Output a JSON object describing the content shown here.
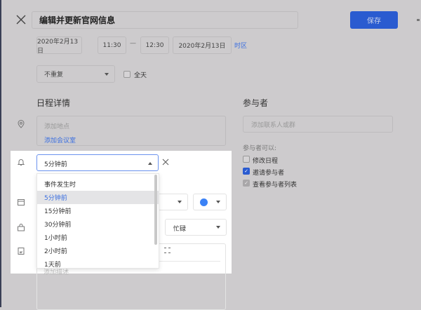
{
  "header": {
    "title": "编辑并更新官网信息",
    "save_label": "保存"
  },
  "time": {
    "start_date": "2020年2月13日",
    "start_time": "11:30",
    "separator": "—",
    "end_time": "12:30",
    "end_date": "2020年2月13日",
    "timezone_link": "时区"
  },
  "repeat": {
    "value": "不重复",
    "all_day_label": "全天",
    "all_day_checked": false
  },
  "details": {
    "heading": "日程详情",
    "location_placeholder": "添加地点",
    "add_room_link": "添加会议室",
    "reminder_value": "5分钟前",
    "busy_value": "忙碌",
    "description_placeholder": "添加描述",
    "calendar_color": "#3b82f6"
  },
  "reminder_options": [
    "事件发生时",
    "5分钟前",
    "15分钟前",
    "30分钟前",
    "1小时前",
    "2小时前",
    "1天前"
  ],
  "attendees": {
    "heading": "参与者",
    "input_placeholder": "添加联系人或群",
    "permissions_label": "参与者可以:",
    "permissions": [
      {
        "label": "修改日程",
        "checked": false
      },
      {
        "label": "邀请参与者",
        "checked": true
      },
      {
        "label": "查看参与者列表",
        "checked": true
      }
    ]
  },
  "colors": {
    "accent": "#2a5bd0",
    "link": "#3b6fe0"
  }
}
